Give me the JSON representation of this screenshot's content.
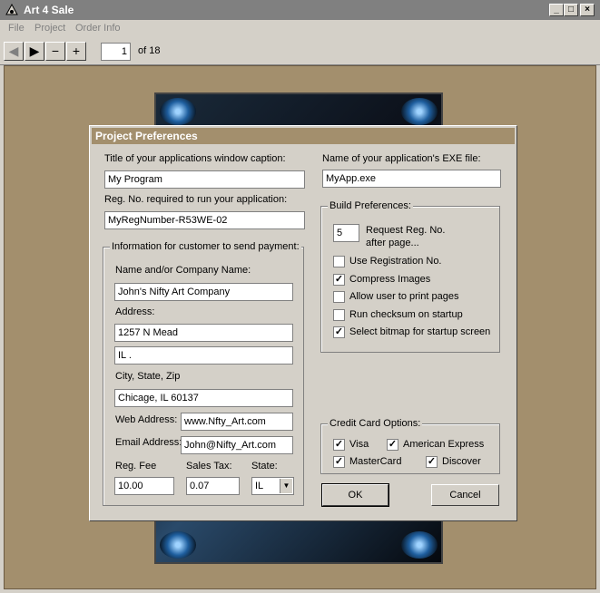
{
  "window": {
    "title": "Art 4 Sale"
  },
  "menu": [
    {
      "label": "File",
      "key": "F"
    },
    {
      "label": "Project",
      "key": "P"
    },
    {
      "label": "Order Info",
      "key": "O"
    }
  ],
  "toolbar": {
    "page_value": "1",
    "page_total": "of 18"
  },
  "dialog": {
    "title": "Project Preferences",
    "caption_label": "Title of your applications window caption:",
    "caption_value": "My Program",
    "regno_label": "Reg. No. required to run your application:",
    "regno_value": "MyRegNumber-R53WE-02",
    "exe_label": "Name of your application's EXE file:",
    "exe_value": "MyApp.exe",
    "payment": {
      "group_label": "Information for customer to send payment:",
      "name_label": "Name and/or Company Name:",
      "name_value": "John's Nifty Art Company",
      "address_label": "Address:",
      "address1": "1257 N Mead",
      "address2": "IL .",
      "city_label": "City, State, Zip",
      "city_value": "Chicage, IL 60137",
      "web_label": "Web Address:",
      "web_value": "www.Nfty_Art.com",
      "email_label": "Email Address:",
      "email_value": "John@Nifty_Art.com",
      "fee_label": "Reg. Fee",
      "fee_value": "10.00",
      "tax_label": "Sales Tax:",
      "tax_value": "0.07",
      "state_label": "State:",
      "state_value": "IL"
    },
    "build": {
      "group_label": "Build Preferences:",
      "page_value": "5",
      "request_label1": "Request Reg. No.",
      "request_label2": "after page...",
      "options": [
        {
          "label": "Use Registration No.",
          "checked": false
        },
        {
          "label": "Compress Images",
          "checked": true
        },
        {
          "label": "Allow user to print pages",
          "checked": false
        },
        {
          "label": "Run checksum on startup",
          "checked": false
        },
        {
          "label": "Select bitmap for startup screen",
          "checked": true
        }
      ]
    },
    "credit": {
      "group_label": "Credit Card Options:",
      "visa": {
        "label": "Visa",
        "checked": true
      },
      "amex": {
        "label": "American Express",
        "checked": true
      },
      "mastercard": {
        "label": "MasterCard",
        "checked": true
      },
      "discover": {
        "label": "Discover",
        "checked": true
      }
    },
    "ok_label": "OK",
    "cancel_label": "Cancel"
  }
}
